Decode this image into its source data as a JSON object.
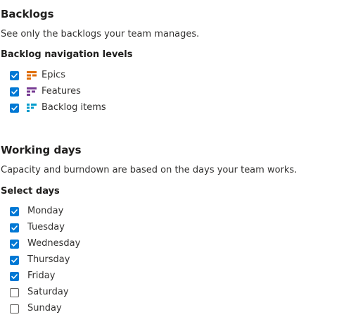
{
  "backlogs": {
    "title": "Backlogs",
    "description": "See only the backlogs your team manages.",
    "levels_title": "Backlog navigation levels",
    "levels": [
      {
        "label": "Epics",
        "checked": true,
        "icon": "epic-icon",
        "color": "#e06c00"
      },
      {
        "label": "Features",
        "checked": true,
        "icon": "feature-icon",
        "color": "#773b93"
      },
      {
        "label": "Backlog items",
        "checked": true,
        "icon": "backlog-item-icon",
        "color": "#009ccc"
      }
    ]
  },
  "working_days": {
    "title": "Working days",
    "description": "Capacity and burndown are based on the days your team works.",
    "select_title": "Select days",
    "days": [
      {
        "label": "Monday",
        "checked": true
      },
      {
        "label": "Tuesday",
        "checked": true
      },
      {
        "label": "Wednesday",
        "checked": true
      },
      {
        "label": "Thursday",
        "checked": true
      },
      {
        "label": "Friday",
        "checked": true
      },
      {
        "label": "Saturday",
        "checked": false
      },
      {
        "label": "Sunday",
        "checked": false
      }
    ]
  },
  "colors": {
    "accent": "#0078d4"
  }
}
